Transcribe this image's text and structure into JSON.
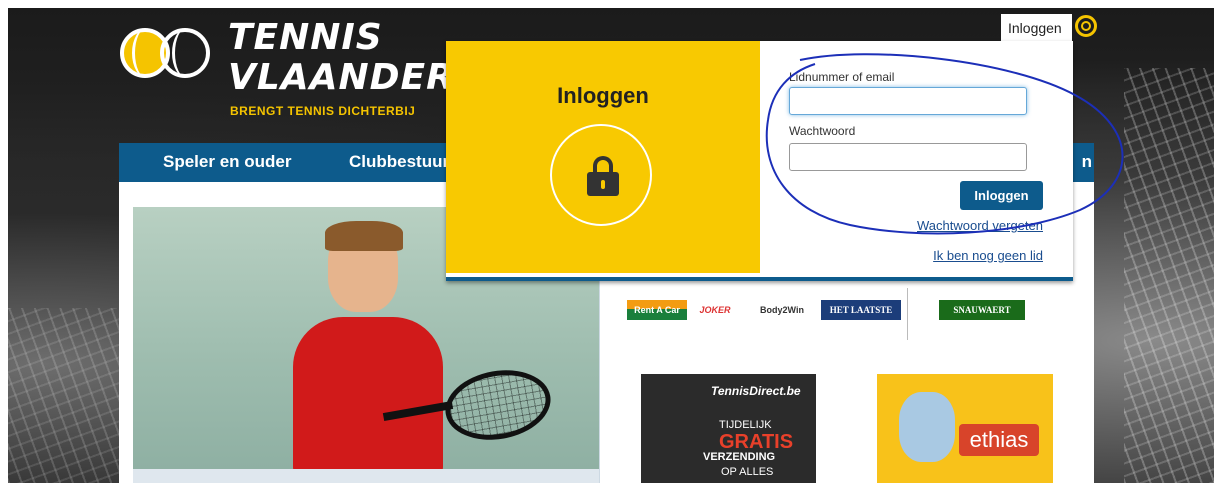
{
  "site": {
    "logo_line1": "TENNIS",
    "logo_line2": "VLAANDEREN",
    "tagline": "BRENGT TENNIS DICHTERBIJ"
  },
  "nav": {
    "items": [
      {
        "label": "Speler en ouder"
      },
      {
        "label": "Clubbestuur"
      },
      {
        "label": "n"
      }
    ]
  },
  "login_trigger": {
    "label": "Inloggen",
    "icon": "ring-icon"
  },
  "login_panel": {
    "title": "Inloggen",
    "icon": "lock-icon",
    "username_label": "Lidnummer of email",
    "username_value": "",
    "password_label": "Wachtwoord",
    "password_value": "",
    "submit_label": "Inloggen",
    "forgot_link": "Wachtwoord vergeten",
    "signup_link": "Ik ben nog geen lid"
  },
  "sponsors": {
    "items": [
      "Rent A Car enterprise",
      "JOKER",
      "Body2Win",
      "HET LAATSTE NIEUWS",
      "SNAUWAERT"
    ]
  },
  "ads": {
    "tennisdirect": {
      "brand": "TennisDirect.be",
      "line1": "TIJDELIJK",
      "line2": "GRATIS",
      "line3": "VERZENDING",
      "line4": "OP ALLES"
    },
    "ethias": {
      "brand": "ethias"
    }
  },
  "colors": {
    "brand_yellow": "#f8c901",
    "brand_blue": "#0d5b8c",
    "annotation_blue": "#1c2fb8"
  }
}
